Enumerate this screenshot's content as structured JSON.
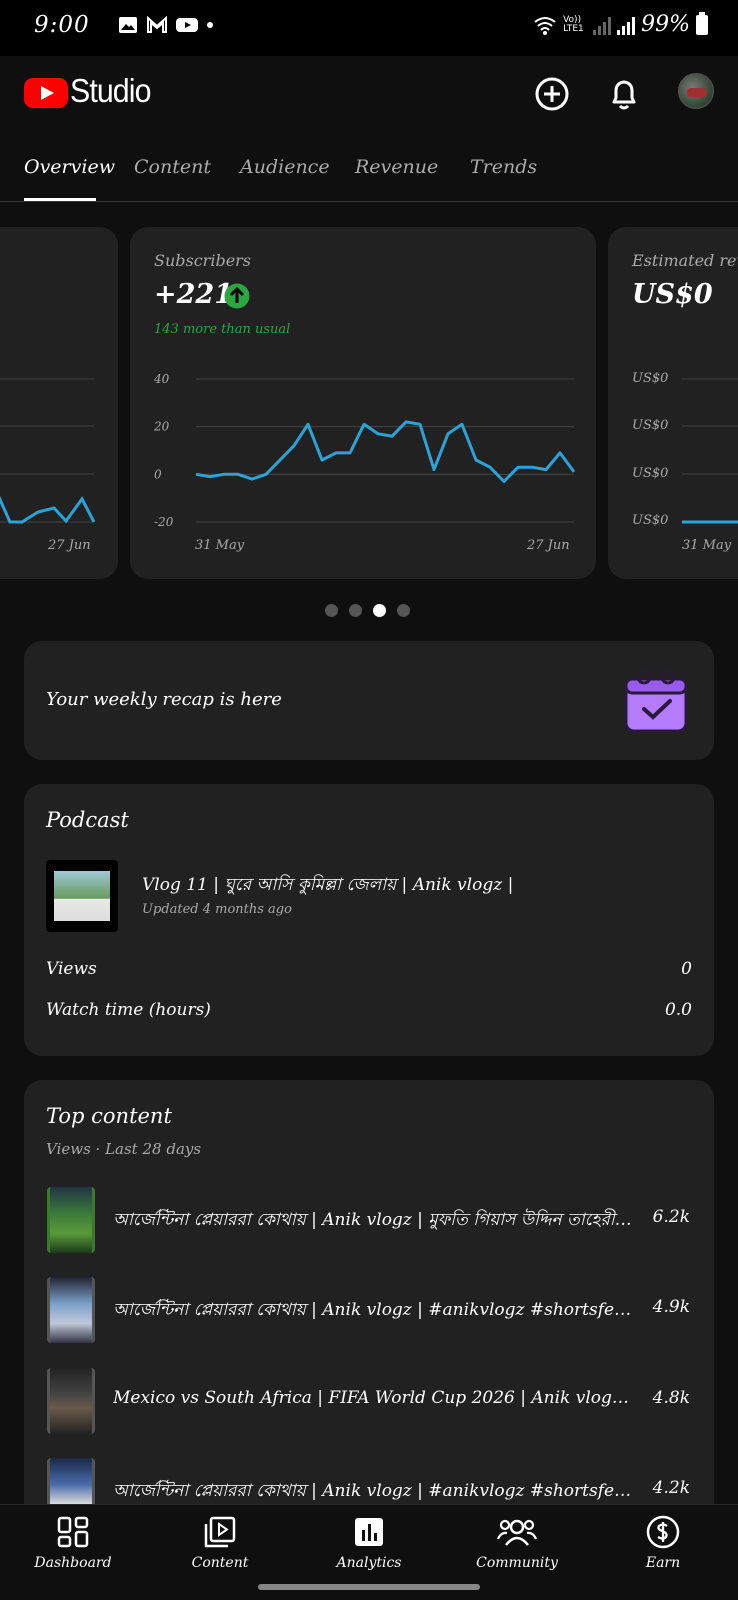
{
  "status_bar": {
    "time": "9:00",
    "lte_label": "Vo)) LTE1",
    "battery": "99%"
  },
  "header": {
    "app_name": "Studio",
    "icons": [
      "youtube-logo-icon",
      "create-plus-icon",
      "bell-icon",
      "avatar"
    ]
  },
  "tabs": [
    {
      "label": "Overview",
      "active": true
    },
    {
      "label": "Content",
      "active": false
    },
    {
      "label": "Audience",
      "active": false
    },
    {
      "label": "Revenue",
      "active": false
    },
    {
      "label": "Trends",
      "active": false
    }
  ],
  "cards": {
    "left_partial": {
      "x_end_label": "27 Jun"
    },
    "subscribers": {
      "label": "Subscribers",
      "value": "+221",
      "trend_icon": "arrow-up-icon",
      "note": "143 more than usual",
      "y_ticks": [
        "40",
        "20",
        "0",
        "-20"
      ],
      "x_start": "31 May",
      "x_end": "27 Jun"
    },
    "revenue": {
      "label": "Estimated rev",
      "value": "US$0",
      "y_ticks": [
        "US$0",
        "US$0",
        "US$0",
        "US$0"
      ],
      "x_start": "31 May"
    }
  },
  "chart_data": {
    "type": "line",
    "title": "Subscribers",
    "ylim": [
      -20,
      40
    ],
    "y_ticks": [
      40,
      20,
      0,
      -20
    ],
    "x_tick_labels": [
      "31 May",
      "27 Jun"
    ],
    "grid": true,
    "series": [
      {
        "values": [
          0,
          -1,
          0,
          0,
          -2,
          0,
          6,
          12,
          21,
          6,
          9,
          9,
          21,
          17,
          16,
          22,
          21,
          2,
          17,
          21,
          6,
          3,
          -3,
          3,
          3,
          2,
          9,
          1
        ]
      }
    ]
  },
  "carousel": {
    "count": 4,
    "active_index": 2
  },
  "recap": {
    "text": "Your weekly recap is here",
    "icon": "calendar-check-icon"
  },
  "podcast": {
    "title": "Podcast",
    "item_title": "Vlog 11 | ঘুরে আসি কুমিল্লা জেলায় | Anik vlogz |",
    "item_subtitle": "Updated 4 months ago",
    "views_label": "Views",
    "views_value": "0",
    "watch_label": "Watch time (hours)",
    "watch_value": "0.0"
  },
  "top_content": {
    "title": "Top content",
    "subtitle": "Views · Last 28 days",
    "items": [
      {
        "title": "আর্জেন্টিনা প্লেয়াররা কোথায় | Anik vlogz | মুফতি গিয়াস উদ্দিন তাহেরী |...",
        "value": "6.2k"
      },
      {
        "title": "আর্জেন্টিনা প্লেয়াররা কোথায় | Anik vlogz | #anikvlogz #shortsfeed #...",
        "value": "4.9k"
      },
      {
        "title": "Mexico vs South Africa | FIFA World Cup 2026 | Anik vlogz | #anikvl...",
        "value": "4.8k"
      },
      {
        "title": "আর্জেন্টিনা প্লেয়াররা কোথায় | Anik vlogz | #anikvlogz #shortsfeed #...",
        "value": "4.2k"
      }
    ]
  },
  "bottom_nav": [
    {
      "label": "Dashboard",
      "icon": "dashboard-icon"
    },
    {
      "label": "Content",
      "icon": "content-play-icon"
    },
    {
      "label": "Analytics",
      "icon": "analytics-icon"
    },
    {
      "label": "Community",
      "icon": "community-icon"
    },
    {
      "label": "Earn",
      "icon": "dollar-icon"
    }
  ]
}
